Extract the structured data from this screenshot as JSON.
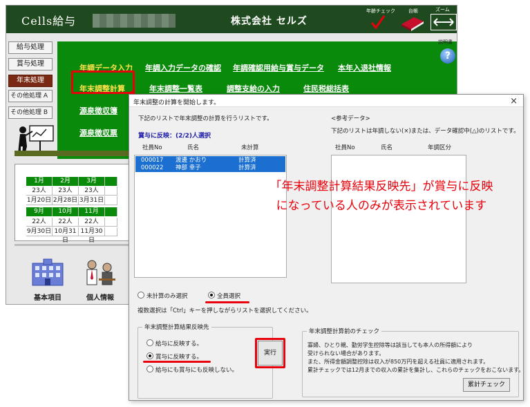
{
  "app": {
    "title": "Cells給与",
    "company": "株式会社 セルズ",
    "age_check_label": "年齢チェック",
    "ledger_label": "台帳",
    "zoom_label": "ズーム",
    "help_label": "説明書",
    "help_glyph": "?"
  },
  "sidebar": {
    "items": [
      {
        "label": "給与処理"
      },
      {
        "label": "賞与処理"
      },
      {
        "label": "年末処理"
      },
      {
        "label": "その他処理 A"
      },
      {
        "label": "その他処理 B"
      }
    ]
  },
  "menu": {
    "row1": [
      "年調データ入力",
      "年調入力データの確認",
      "年調確認用給与賞与データ",
      "本年入退社情報"
    ],
    "row2": [
      "年末調整計算",
      "年末調整一覧表",
      "調整支給の入力",
      "住民税総括表"
    ],
    "row3": [
      "源泉徴収簿"
    ],
    "row4": [
      "源泉徴収票"
    ]
  },
  "calendar": {
    "months_a": [
      "1月",
      "2月",
      "3月"
    ],
    "counts_a": [
      "23人",
      "23人",
      "23人"
    ],
    "dates_a": [
      "1月20日",
      "2月28日",
      "3月31日"
    ],
    "months_b": [
      "9月",
      "10月",
      "11月"
    ],
    "counts_b": [
      "22人",
      "22人",
      "22人"
    ],
    "dates_b": [
      "9月30日",
      "10月31日",
      "11月30日"
    ]
  },
  "tiles": [
    {
      "label": "基本項目",
      "icon": "building-icon"
    },
    {
      "label": "個人情報",
      "icon": "people-icon"
    }
  ],
  "dialog": {
    "title": "年末調整の計算を開始します。",
    "instruction": "下記のリストで年末調整の計算を行うリストです。",
    "selection_status": "賞与に反映：(2/2)人選択",
    "columns_left": [
      "社員No",
      "氏名",
      "未計算"
    ],
    "rows_left": [
      {
        "no": "000017",
        "name": "渡邊 かおり",
        "status": "計算済"
      },
      {
        "no": "000022",
        "name": "神部 幸子",
        "status": "計算済"
      }
    ],
    "ref_heading": "<参考データ>",
    "ref_desc": "下記のリストは年調しない(×)または、データ確認中(△)のリストです。",
    "columns_right": [
      "社員No",
      "氏名",
      "年調区分"
    ],
    "radio_uncalculated": "未計算のみ選択",
    "radio_all": "全員選択",
    "multi_select_hint": "複数選択は「Ctrl」キーを押しながらリストを選択してください。",
    "reflect_group_title": "年末調整計算結果反映先",
    "reflect_options": [
      "給与に反映する。",
      "賞与に反映する。",
      "給与にも賞与にも反映しない。"
    ],
    "execute_label": "実行",
    "check_group_title": "年末調整計算前のチェック",
    "check_text": [
      "寡婦、ひとり親、勤労学生控除等は該当しても本人の所得額により",
      "受けられない場合があります。",
      "また、所得金額調整控除は収入が850万円を超える社員に適用されます。",
      "累計チェックでは12月までの収入の累計を集計し、これらのチェックをおこないます。"
    ],
    "cumulative_check_label": "累計チェック",
    "close_glyph": "×"
  },
  "callout": {
    "line1": "「年末調整計算結果反映先」が賞与に反映",
    "line2": "になっている人のみが表示されています"
  },
  "colors": {
    "title_bar": "#1f4a1f",
    "menu_panel": "#0a8a0a",
    "highlight_red": "#e8000a",
    "selection_blue": "#1a6fd0"
  }
}
